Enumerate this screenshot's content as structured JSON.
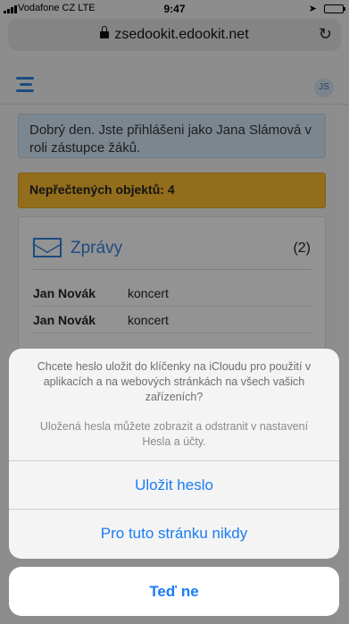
{
  "status_bar": {
    "carrier": "Vodafone CZ  LTE",
    "time": "9:47",
    "location_icon": "location-arrow-icon",
    "battery_icon": "battery-icon"
  },
  "browser": {
    "url": "zsedookit.edookit.net",
    "lock_icon": "lock-icon",
    "reload_icon": "reload-icon"
  },
  "header": {
    "menu_icon": "hamburger-menu-icon",
    "avatar_initials": "JS"
  },
  "notice": {
    "text": "Dobrý den. Jste přihlášeni jako Jana Slámová v roli zástupce žáků."
  },
  "unread_banner": {
    "text": "Nepřečtených objektů: 4"
  },
  "messages_panel": {
    "icon": "envelope-icon",
    "title": "Zprávy",
    "count": "(2)",
    "items": [
      {
        "sender": "Jan Novák",
        "subject": "koncert"
      },
      {
        "sender": "Jan Novák",
        "subject": "koncert"
      }
    ]
  },
  "action_sheet": {
    "title": "Chcete heslo uložit do klíčenky na iCloudu pro použití v aplikacích a na webových stránkách na všech vašich zařízeních?",
    "subtitle": "Uložená hesla můžete zobrazit a odstranit v nastavení Hesla a účty.",
    "save_button": "Uložit heslo",
    "never_button": "Pro tuto stránku nikdy",
    "cancel_button": "Teď ne"
  },
  "colors": {
    "accent": "#1a7cf5",
    "brand_blue": "#2f7fd6",
    "warning": "#f2b630",
    "info": "#cfe0ee"
  }
}
